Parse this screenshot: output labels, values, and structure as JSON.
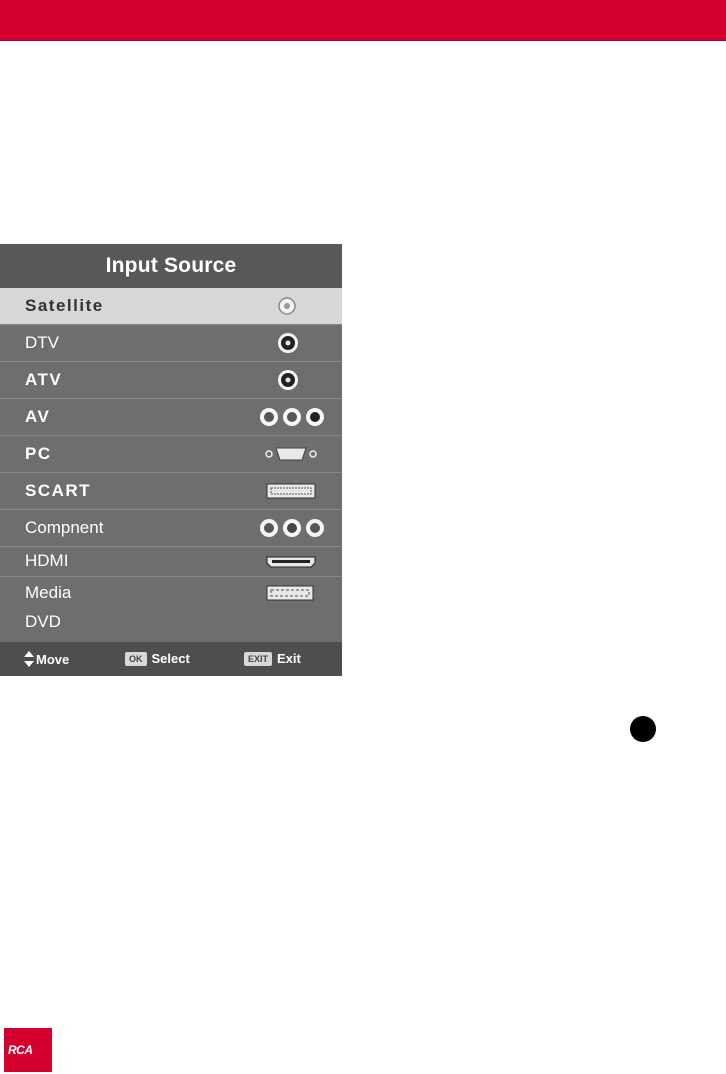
{
  "menu": {
    "title": "Input Source",
    "items": [
      {
        "label": "Satellite",
        "icon": "satellite-connector-icon"
      },
      {
        "label": "DTV",
        "icon": "coax-connector-icon"
      },
      {
        "label": "ATV",
        "icon": "coax-connector-icon"
      },
      {
        "label": "AV",
        "icon": "rca-connectors-icon"
      },
      {
        "label": "PC",
        "icon": "vga-connector-icon"
      },
      {
        "label": "SCART",
        "icon": "scart-connector-icon"
      },
      {
        "label": "Compnent",
        "icon": "component-connectors-icon"
      },
      {
        "label": "HDMI",
        "icon": "hdmi-connector-icon"
      },
      {
        "label": "Media",
        "icon": "usb-connector-icon"
      },
      {
        "label": "DVD",
        "icon": ""
      }
    ],
    "selected_index": 0
  },
  "footer": {
    "move_label": "Move",
    "ok_key": "OK",
    "select_label": "Select",
    "exit_key": "EXIT",
    "exit_label": "Exit"
  },
  "logo": {
    "text": "RCA"
  },
  "colors": {
    "brand": "#d6002e",
    "menu_bg": "#6e6e6e",
    "selected_bg": "#d7d7d7"
  }
}
